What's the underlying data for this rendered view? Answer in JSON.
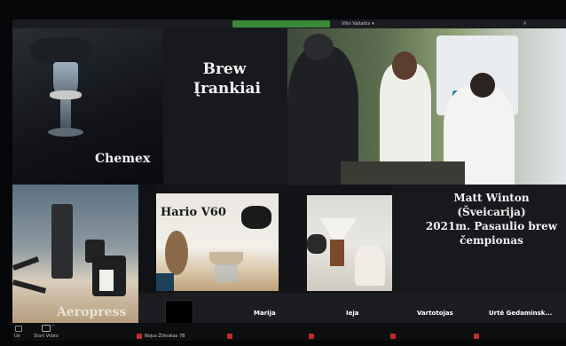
{
  "window": {
    "speaker_view": "Vilni Vaitaitis",
    "top_right": "A"
  },
  "slides": {
    "brew_title_line1": "Brew",
    "brew_title_line2": "Įrankiai",
    "chemex": "Chemex",
    "hario": "Hario V60",
    "aeropress": "Aeropress",
    "matt_line1": "Matt Winton",
    "matt_line2": "(Šveicarija)",
    "matt_line3": "2021m. Pasaulio brew",
    "matt_line4": "čempionas"
  },
  "participants_strip": [
    {
      "name": "Marija"
    },
    {
      "name": "Ieja"
    },
    {
      "name": "Vartotojas"
    },
    {
      "name": "Urtė Gedaminsk..."
    }
  ],
  "toolbar": {
    "audio": "Ue",
    "start_video": "Start Video",
    "participant_1": "Nojus Žilinskas 7B"
  },
  "colors": {
    "active_speaker": "#3a8a3a",
    "muted_icon": "#c02c2c"
  }
}
